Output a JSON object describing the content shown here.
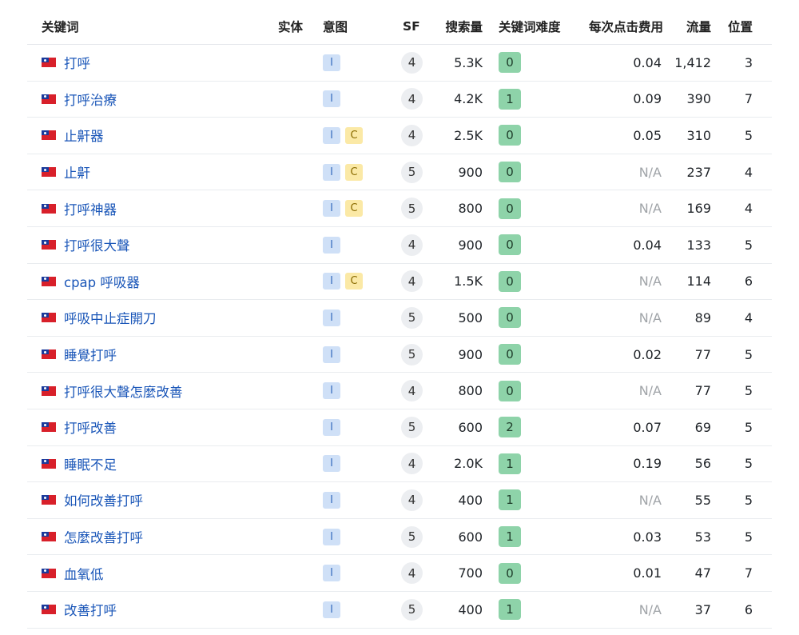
{
  "header": {
    "keyword": "关键词",
    "entity": "实体",
    "intent": "意图",
    "sf": "SF",
    "volume": "搜索量",
    "kd": "关键词难度",
    "cpc": "每次点击费用",
    "traffic": "流量",
    "position": "位置"
  },
  "flag_icon": "taiwan-flag-icon",
  "rows": [
    {
      "keyword": "打呼",
      "intents": [
        "I"
      ],
      "sf": "4",
      "volume": "5.3K",
      "kd": "0",
      "cpc": "0.04",
      "traffic": "1,412",
      "position": "3"
    },
    {
      "keyword": "打呼治療",
      "intents": [
        "I"
      ],
      "sf": "4",
      "volume": "4.2K",
      "kd": "1",
      "cpc": "0.09",
      "traffic": "390",
      "position": "7"
    },
    {
      "keyword": "止鼾器",
      "intents": [
        "I",
        "C"
      ],
      "sf": "4",
      "volume": "2.5K",
      "kd": "0",
      "cpc": "0.05",
      "traffic": "310",
      "position": "5"
    },
    {
      "keyword": "止鼾",
      "intents": [
        "I",
        "C"
      ],
      "sf": "5",
      "volume": "900",
      "kd": "0",
      "cpc": "N/A",
      "traffic": "237",
      "position": "4"
    },
    {
      "keyword": "打呼神器",
      "intents": [
        "I",
        "C"
      ],
      "sf": "5",
      "volume": "800",
      "kd": "0",
      "cpc": "N/A",
      "traffic": "169",
      "position": "4"
    },
    {
      "keyword": "打呼很大聲",
      "intents": [
        "I"
      ],
      "sf": "4",
      "volume": "900",
      "kd": "0",
      "cpc": "0.04",
      "traffic": "133",
      "position": "5"
    },
    {
      "keyword": "cpap 呼吸器",
      "intents": [
        "I",
        "C"
      ],
      "sf": "4",
      "volume": "1.5K",
      "kd": "0",
      "cpc": "N/A",
      "traffic": "114",
      "position": "6"
    },
    {
      "keyword": "呼吸中止症開刀",
      "intents": [
        "I"
      ],
      "sf": "5",
      "volume": "500",
      "kd": "0",
      "cpc": "N/A",
      "traffic": "89",
      "position": "4"
    },
    {
      "keyword": "睡覺打呼",
      "intents": [
        "I"
      ],
      "sf": "5",
      "volume": "900",
      "kd": "0",
      "cpc": "0.02",
      "traffic": "77",
      "position": "5"
    },
    {
      "keyword": "打呼很大聲怎麼改善",
      "intents": [
        "I"
      ],
      "sf": "4",
      "volume": "800",
      "kd": "0",
      "cpc": "N/A",
      "traffic": "77",
      "position": "5"
    },
    {
      "keyword": "打呼改善",
      "intents": [
        "I"
      ],
      "sf": "5",
      "volume": "600",
      "kd": "2",
      "cpc": "0.07",
      "traffic": "69",
      "position": "5"
    },
    {
      "keyword": "睡眠不足",
      "intents": [
        "I"
      ],
      "sf": "4",
      "volume": "2.0K",
      "kd": "1",
      "cpc": "0.19",
      "traffic": "56",
      "position": "5"
    },
    {
      "keyword": "如何改善打呼",
      "intents": [
        "I"
      ],
      "sf": "4",
      "volume": "400",
      "kd": "1",
      "cpc": "N/A",
      "traffic": "55",
      "position": "5"
    },
    {
      "keyword": "怎麼改善打呼",
      "intents": [
        "I"
      ],
      "sf": "5",
      "volume": "600",
      "kd": "1",
      "cpc": "0.03",
      "traffic": "53",
      "position": "5"
    },
    {
      "keyword": "血氧低",
      "intents": [
        "I"
      ],
      "sf": "4",
      "volume": "700",
      "kd": "0",
      "cpc": "0.01",
      "traffic": "47",
      "position": "7"
    },
    {
      "keyword": "改善打呼",
      "intents": [
        "I"
      ],
      "sf": "5",
      "volume": "400",
      "kd": "1",
      "cpc": "N/A",
      "traffic": "37",
      "position": "6"
    }
  ]
}
